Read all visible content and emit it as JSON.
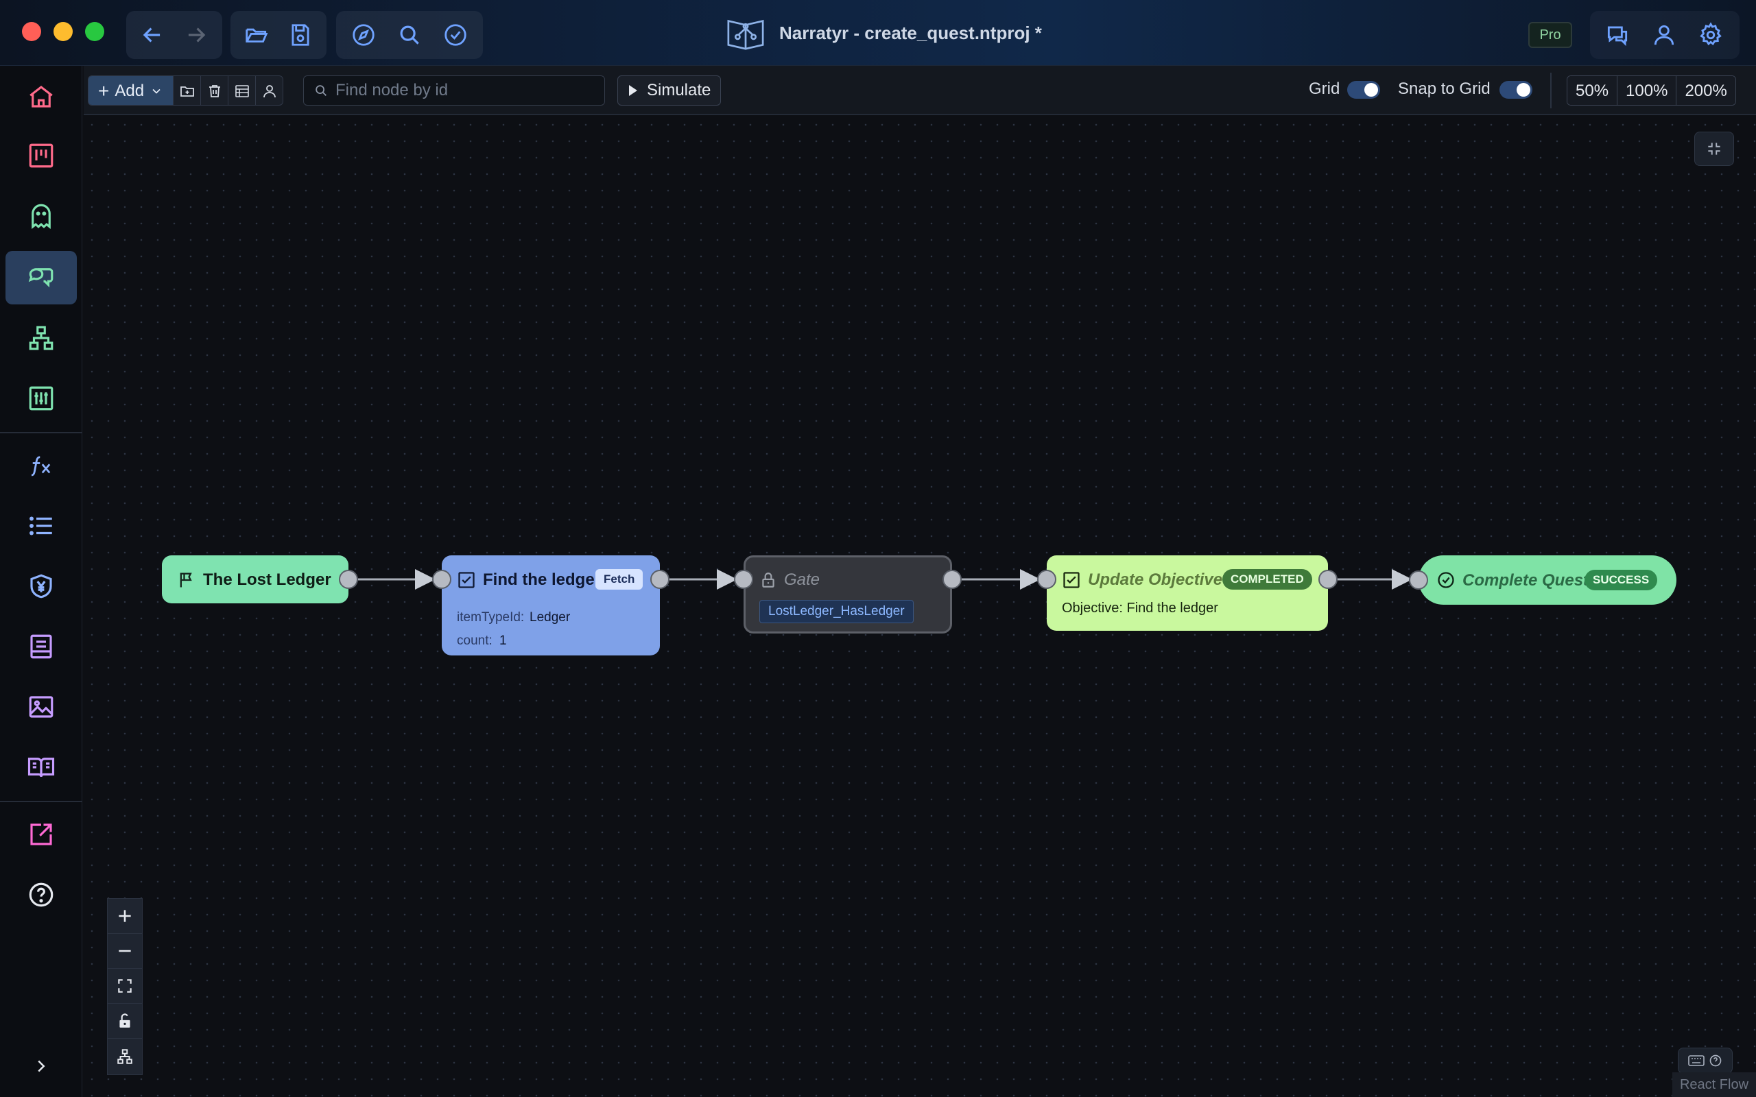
{
  "window": {
    "title": "Narratyr - create_quest.ntproj *",
    "plan_badge": "Pro"
  },
  "toolbar": {
    "add_label": "Add",
    "search_placeholder": "Find node by id",
    "simulate_label": "Simulate",
    "grid_label": "Grid",
    "grid_enabled": true,
    "snap_label": "Snap to Grid",
    "snap_enabled": true,
    "zoom_options": [
      "50%",
      "100%",
      "200%"
    ]
  },
  "sidebar": {
    "items": [
      {
        "icon": "home-icon"
      },
      {
        "icon": "kanban-board-icon"
      },
      {
        "icon": "ghost-icon"
      },
      {
        "icon": "dialogue-bubbles-icon",
        "active": true
      },
      {
        "icon": "hierarchy-icon"
      },
      {
        "icon": "sliders-icon"
      },
      {
        "icon": "function-icon"
      },
      {
        "icon": "list-icon"
      },
      {
        "icon": "currency-shield-icon"
      },
      {
        "icon": "document-icon"
      },
      {
        "icon": "image-icon"
      },
      {
        "icon": "book-icon"
      },
      {
        "icon": "export-icon"
      },
      {
        "icon": "help-icon"
      },
      {
        "icon": "expand-chevron-icon"
      }
    ]
  },
  "graph": {
    "nodes": [
      {
        "id": "start",
        "title": "The Lost Ledger",
        "icon": "flag-icon",
        "color": "#7fe3b0"
      },
      {
        "id": "fetch",
        "title": "Find the ledger",
        "badge": "Fetch",
        "icon": "checkbox-icon",
        "color": "#7fa1e8",
        "fields": [
          {
            "key": "itemTypeId:",
            "value": "Ledger"
          },
          {
            "key": "count:",
            "value": "1"
          }
        ]
      },
      {
        "id": "gate",
        "title": "Gate",
        "icon": "lock-icon",
        "tag": "LostLedger_HasLedger",
        "color": "#34363c"
      },
      {
        "id": "update",
        "title": "Update Objective",
        "badge": "COMPLETED",
        "icon": "checkbox-icon",
        "subtitle": "Objective: Find the ledger",
        "color": "#c9f89e"
      },
      {
        "id": "complete",
        "title": "Complete Quest",
        "badge": "SUCCESS",
        "icon": "check-circle-icon",
        "color": "#7fe3a6"
      }
    ],
    "edges": [
      [
        "start",
        "fetch"
      ],
      [
        "fetch",
        "gate"
      ],
      [
        "gate",
        "update"
      ],
      [
        "update",
        "complete"
      ]
    ]
  },
  "footer": {
    "attribution": "React Flow"
  }
}
